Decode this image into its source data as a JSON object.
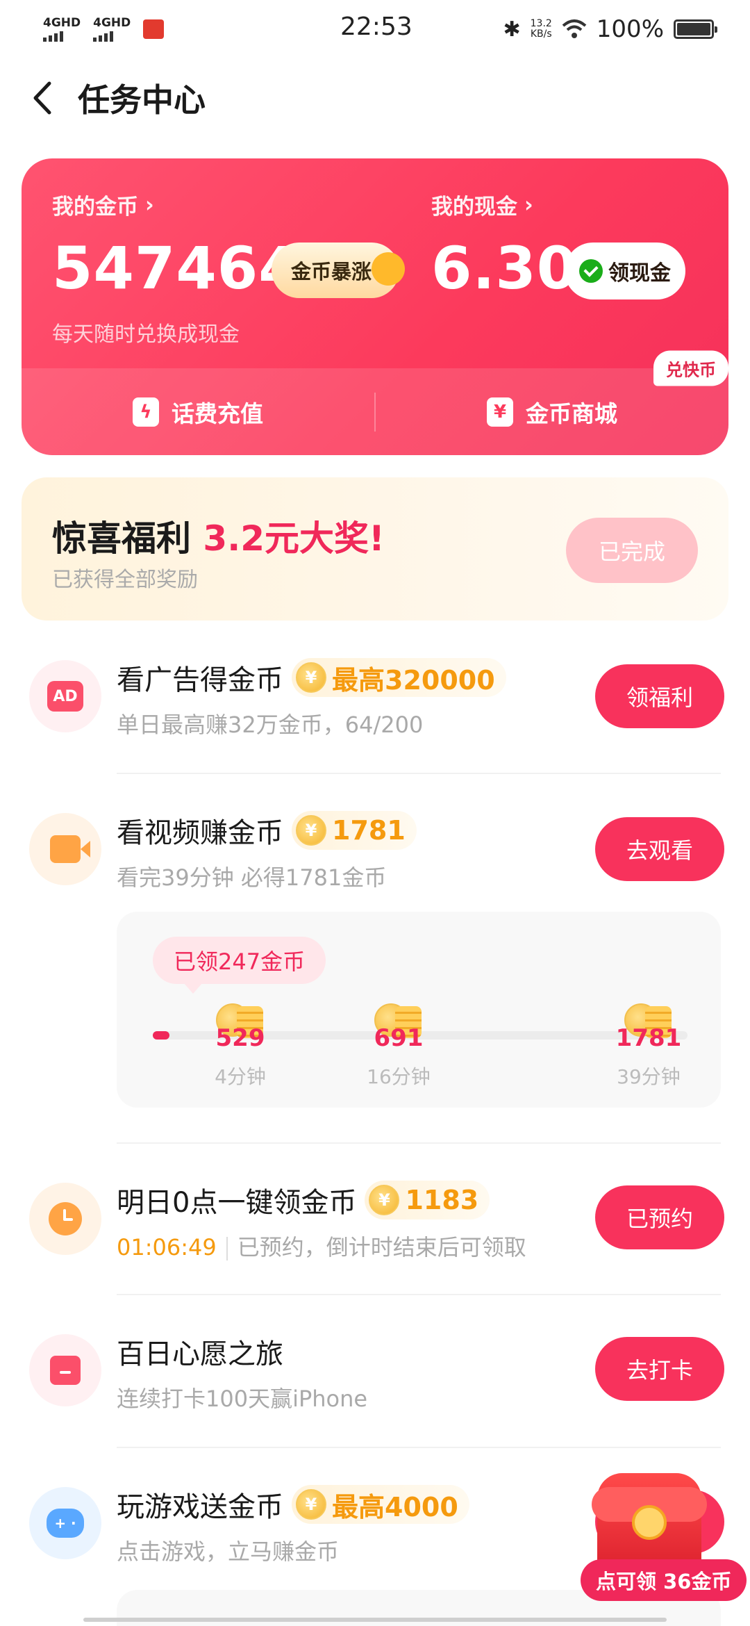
{
  "status_bar": {
    "signal_1": "4GHD",
    "signal_2": "4GHD",
    "time": "22:53",
    "net_speed_value": "13.2",
    "net_speed_unit": "KB/s",
    "battery": "100%"
  },
  "header": {
    "title": "任务中心"
  },
  "coin_card": {
    "coins_label": "我的金币",
    "coins_value": "547464",
    "boost_label": "金币暴涨",
    "cash_label": "我的现金",
    "cash_value": "6.30",
    "withdraw_label": "领现金",
    "subtitle": "每天随时兑换成现金",
    "recharge_label": "话费充值",
    "mall_label": "金币商城",
    "mall_tag": "兑快币"
  },
  "surprise": {
    "title": "惊喜福利",
    "highlight": "3.2元大奖!",
    "subtitle": "已获得全部奖励",
    "button": "已完成"
  },
  "tasks": [
    {
      "title": "看广告得金币",
      "reward": "最高320000",
      "sub": "单日最高赚32万金币，64/200",
      "button": "领福利"
    },
    {
      "title": "看视频赚金币",
      "reward": "1781",
      "sub": "看完39分钟 必得1781金币",
      "button": "去观看"
    },
    {
      "title": "明日0点一键领金币",
      "reward": "1183",
      "countdown": "01:06:49",
      "sub": "已预约，倒计时结束后可领取",
      "button": "已预约"
    },
    {
      "title": "百日心愿之旅",
      "sub": "连续打卡100天赢iPhone",
      "button": "去打卡"
    },
    {
      "title": "玩游戏送金币",
      "reward": "最高4000",
      "sub": "点击游戏，立马赚金币"
    }
  ],
  "video_progress": {
    "claimed": "已领247金币",
    "nodes": [
      {
        "coins": "529",
        "time": "4分钟"
      },
      {
        "coins": "691",
        "time": "16分钟"
      },
      {
        "coins": "1781",
        "time": "39分钟"
      }
    ]
  },
  "floating": {
    "label": "点可领 36金币"
  },
  "icons": {
    "ad": "ad-icon",
    "video": "video-camera-icon",
    "clock": "clock-icon",
    "gift": "gift-icon",
    "game": "gamepad-icon"
  },
  "colors": {
    "accent": "#f8325c",
    "coin_gold": "#f59a0e",
    "card_red": "#fc3a5c"
  }
}
